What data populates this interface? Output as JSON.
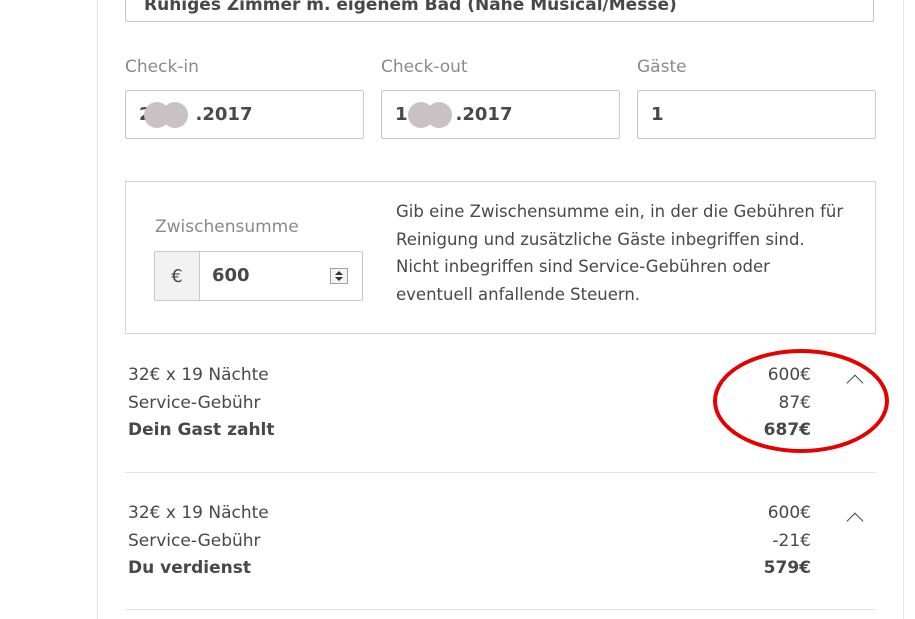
{
  "listing": {
    "title": "Ruhiges Zimmer m. eigenem Bad (Nähe Musical/Messe)"
  },
  "booking": {
    "checkin": {
      "label": "Check-in",
      "prefix": "2",
      "suffix": ".2017"
    },
    "checkout": {
      "label": "Check-out",
      "prefix": "1",
      "suffix": ".2017"
    },
    "guests": {
      "label": "Gäste",
      "value": "1"
    }
  },
  "subtotal": {
    "label": "Zwischensumme",
    "currency": "€",
    "value": "600",
    "help": "Gib eine Zwischensumme ein, in der die Gebühren für Reinigung und zusätzliche Gäste inbegriffen sind. Nicht inbegriffen sind Service-Gebühren oder eventuell anfallende Steuern."
  },
  "guest_breakdown": {
    "nights_label": "32€ x 19 Nächte",
    "nights_amount": "600€",
    "fee_label": "Service-Gebühr",
    "fee_amount": "87€",
    "total_label": "Dein Gast zahlt",
    "total_amount": "687€"
  },
  "host_breakdown": {
    "nights_label": "32€ x 19 Nächte",
    "nights_amount": "600€",
    "fee_label": "Service-Gebühr",
    "fee_amount": "-21€",
    "total_label": "Du verdienst",
    "total_amount": "579€"
  },
  "colors": {
    "annotation": "#e60000",
    "text": "#484848",
    "muted": "#8a8a8a",
    "border": "#c8c8c8"
  },
  "icons": {
    "chevron": "chevron-up-icon",
    "spinner": "number-spinner-icon"
  }
}
